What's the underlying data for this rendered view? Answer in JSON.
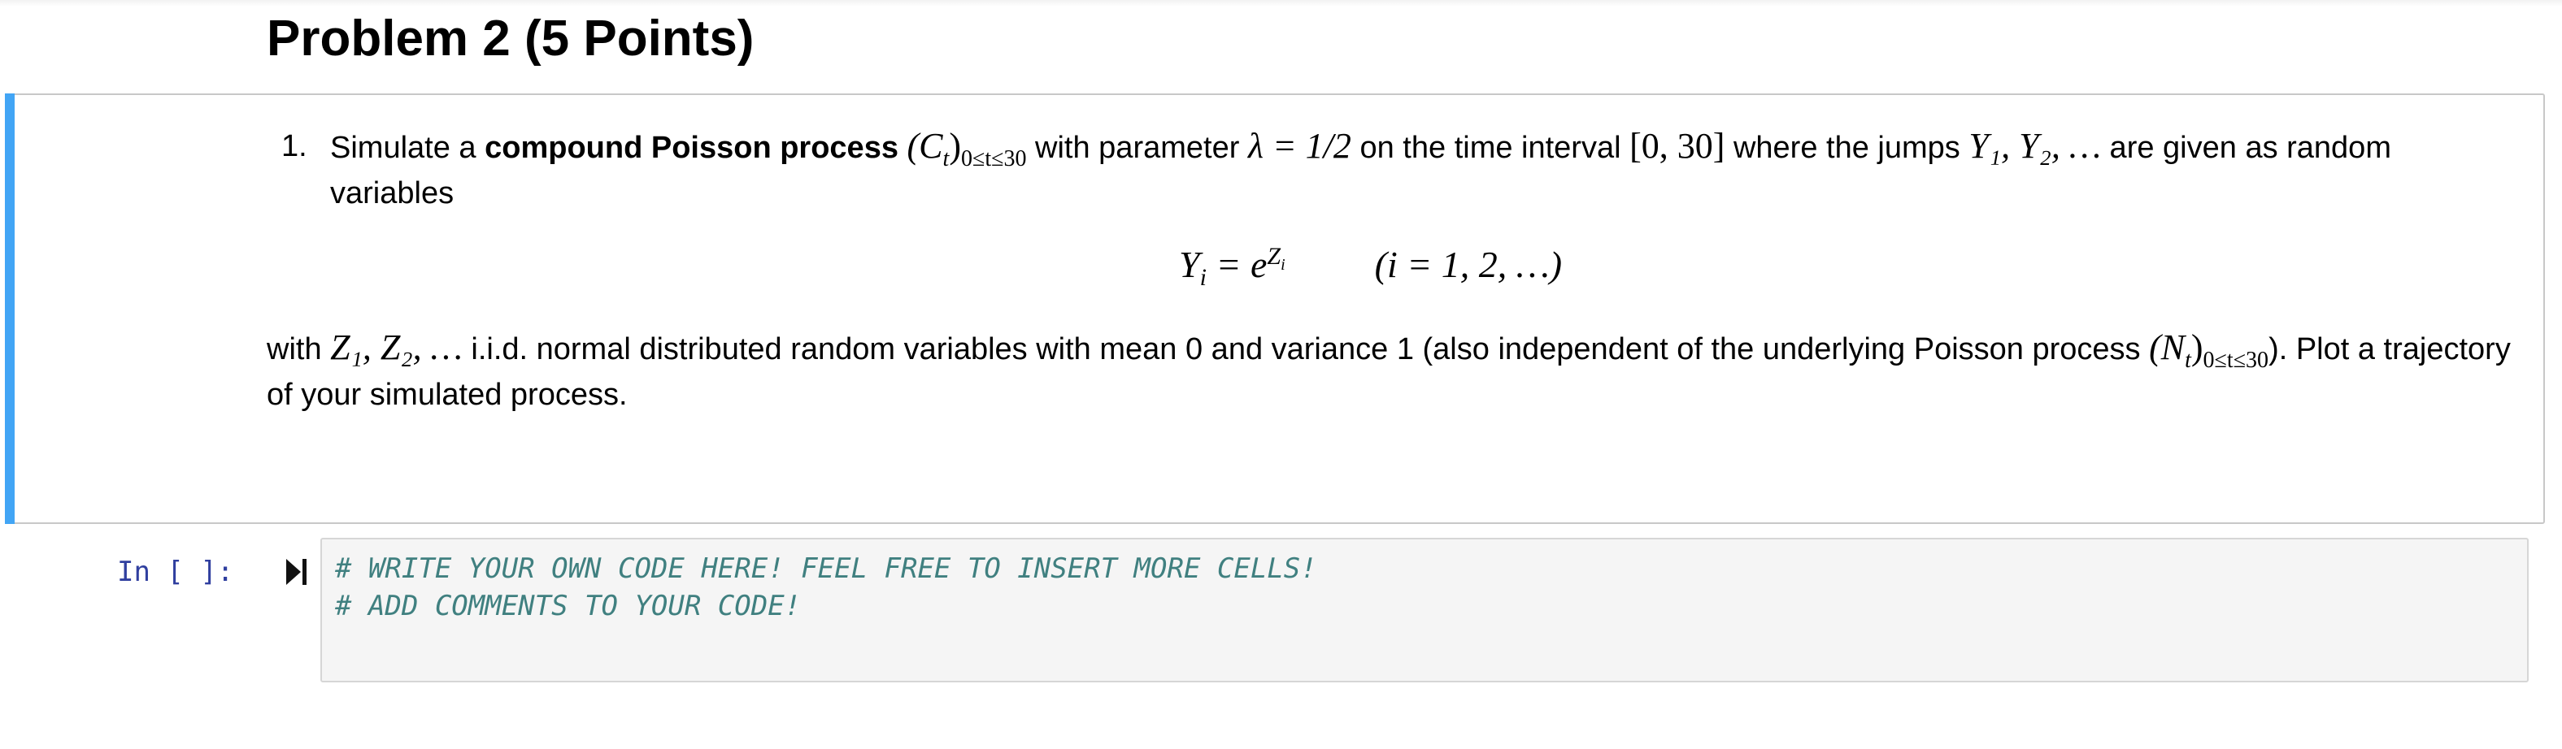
{
  "heading": "Problem 2 (5 Points)",
  "markdown_cell": {
    "list_number": "1.",
    "text_simulate": "Simulate a ",
    "text_bold": "compound Poisson process",
    "math_process": "(C",
    "math_process_sub_t": "t",
    "math_process_close": ")",
    "math_process_range": "0≤t≤30",
    "text_with_param": " with parameter ",
    "math_lambda": "λ = 1/2",
    "text_on_interval": " on the time interval ",
    "math_interval": "[0, 30]",
    "text_where_jumps": " where the jumps ",
    "math_jumps": "Y₁, Y₂, …",
    "text_are_given": " are given as random variables",
    "eq_lhs": "Y",
    "eq_lhs_sub": "i",
    "eq_eq": " = e",
    "eq_sup": "Z",
    "eq_sup_sub": "i",
    "eq_index": "(i = 1, 2, …)",
    "para_with": "with ",
    "para_math_z": "Z₁, Z₂, …",
    "para_text_1": " i.i.d. normal distributed random variables with mean 0 and variance 1 (also independent of the underlying Poisson process ",
    "para_math_n": "(N",
    "para_math_n_sub": "t",
    "para_math_n_close": ")",
    "para_math_n_range": "0≤t≤30",
    "para_text_2": "). Plot a trajectory of your simulated process."
  },
  "code_cell": {
    "prompt": "In [ ]:",
    "lines": [
      "# WRITE YOUR OWN CODE HERE! FEEL FREE TO INSERT MORE CELLS!",
      "# ADD COMMENTS TO YOUR CODE!"
    ]
  },
  "colors": {
    "selection_bar": "#42a5f5",
    "prompt": "#303f9f",
    "comment": "#408080",
    "code_background": "#f5f5f5"
  }
}
